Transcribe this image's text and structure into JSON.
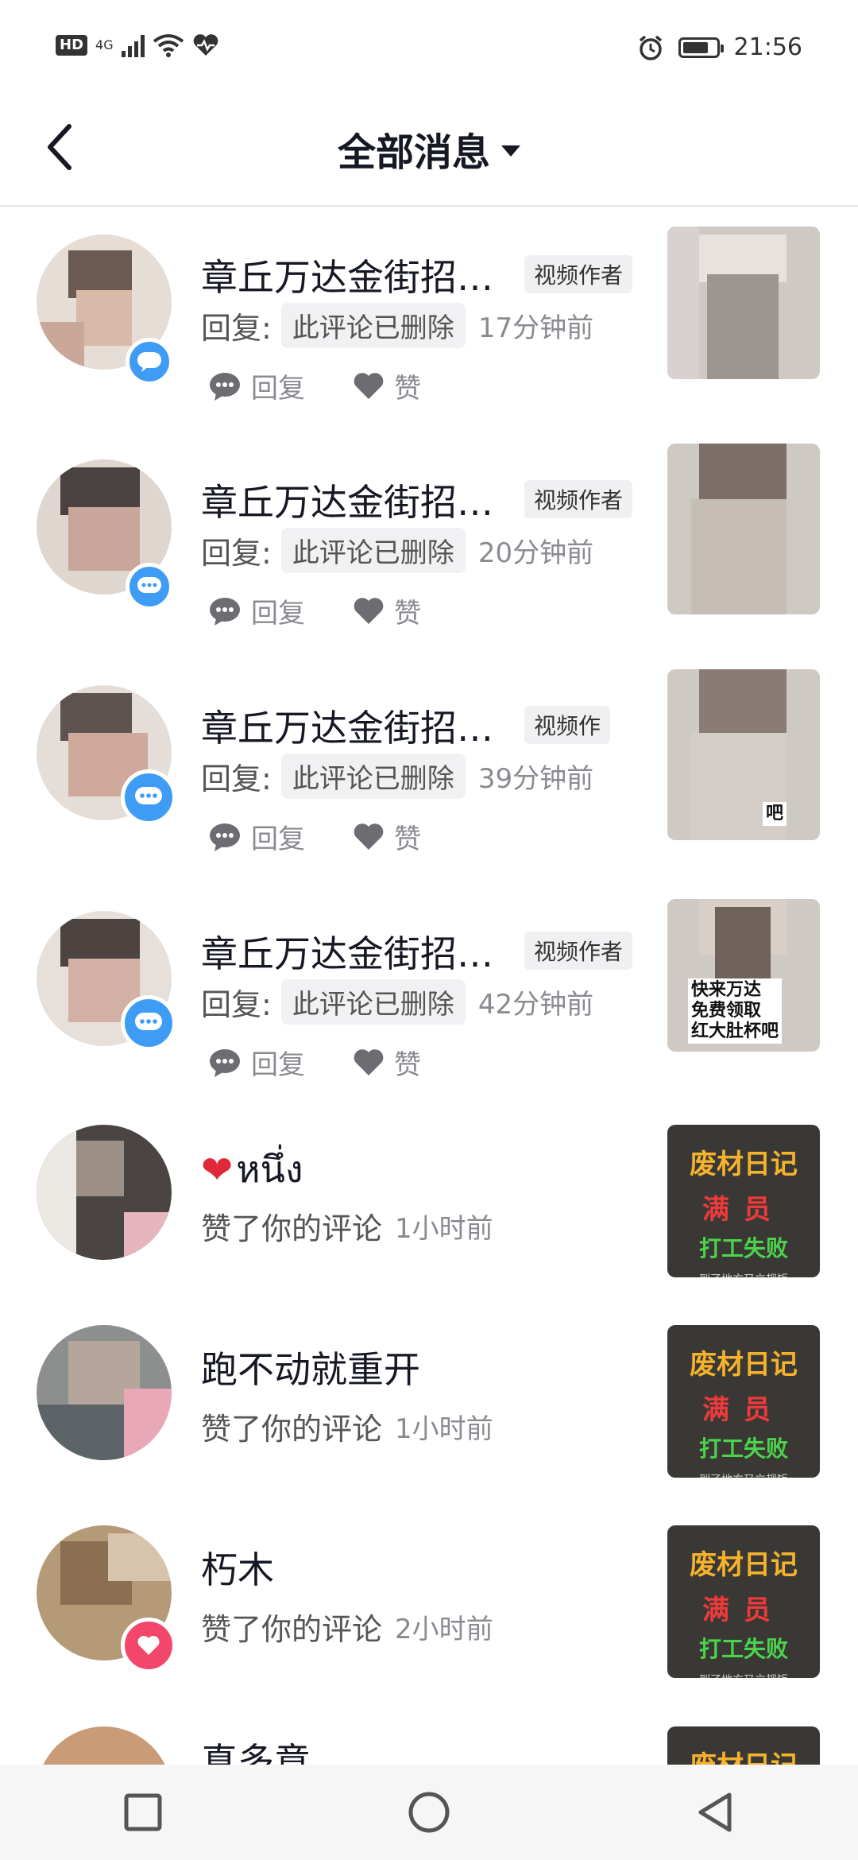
{
  "status_bar": {
    "hd": "HD",
    "network": "4G",
    "time": "21:56",
    "icons": [
      "signal-icon",
      "wifi-icon",
      "heart-rate-icon",
      "alarm-icon",
      "battery-icon"
    ]
  },
  "header": {
    "title": "全部消息"
  },
  "messages": [
    {
      "name": "章丘万达金街招…",
      "tag": "视频作者",
      "reply_label": "回复:",
      "deleted_text": "此评论已删除",
      "time": "17分钟前",
      "reply_action": "回复",
      "like_action": "赞"
    },
    {
      "name": "章丘万达金街招…",
      "tag": "视频作者",
      "reply_label": "回复:",
      "deleted_text": "此评论已删除",
      "time": "20分钟前",
      "reply_action": "回复",
      "like_action": "赞"
    },
    {
      "name": "章丘万达金街招…",
      "tag": "视频作",
      "reply_label": "回复:",
      "deleted_text": "此评论已删除",
      "time": "39分钟前",
      "reply_action": "回复",
      "like_action": "赞",
      "thumb_caption": "吧"
    },
    {
      "name": "章丘万达金街招…",
      "tag": "视频作者",
      "reply_label": "回复:",
      "deleted_text": "此评论已删除",
      "time": "42分钟前",
      "reply_action": "回复",
      "like_action": "赞",
      "thumb_caption": "快来万达\n免费领取\n红大肚杯吧"
    }
  ],
  "likes": [
    {
      "name": "หนึ่ง",
      "emoji": "❤️",
      "action_text": "赞了你的评论",
      "time": "1小时前"
    },
    {
      "name": "跑不动就重开",
      "action_text": "赞了你的评论",
      "time": "1小时前"
    },
    {
      "name": "朽木",
      "action_text": "赞了你的评论",
      "time": "2小时前"
    },
    {
      "name": "真多意"
    }
  ],
  "thumb_dark": {
    "title": "废材日记",
    "line1": "满员",
    "line2": "打工失败",
    "line3": "到了地方又立规矩"
  },
  "colors": {
    "comment_badge": "#3f9cf5",
    "like_badge": "#f2476a",
    "text_primary": "#161823",
    "text_secondary": "#8a8b91"
  }
}
